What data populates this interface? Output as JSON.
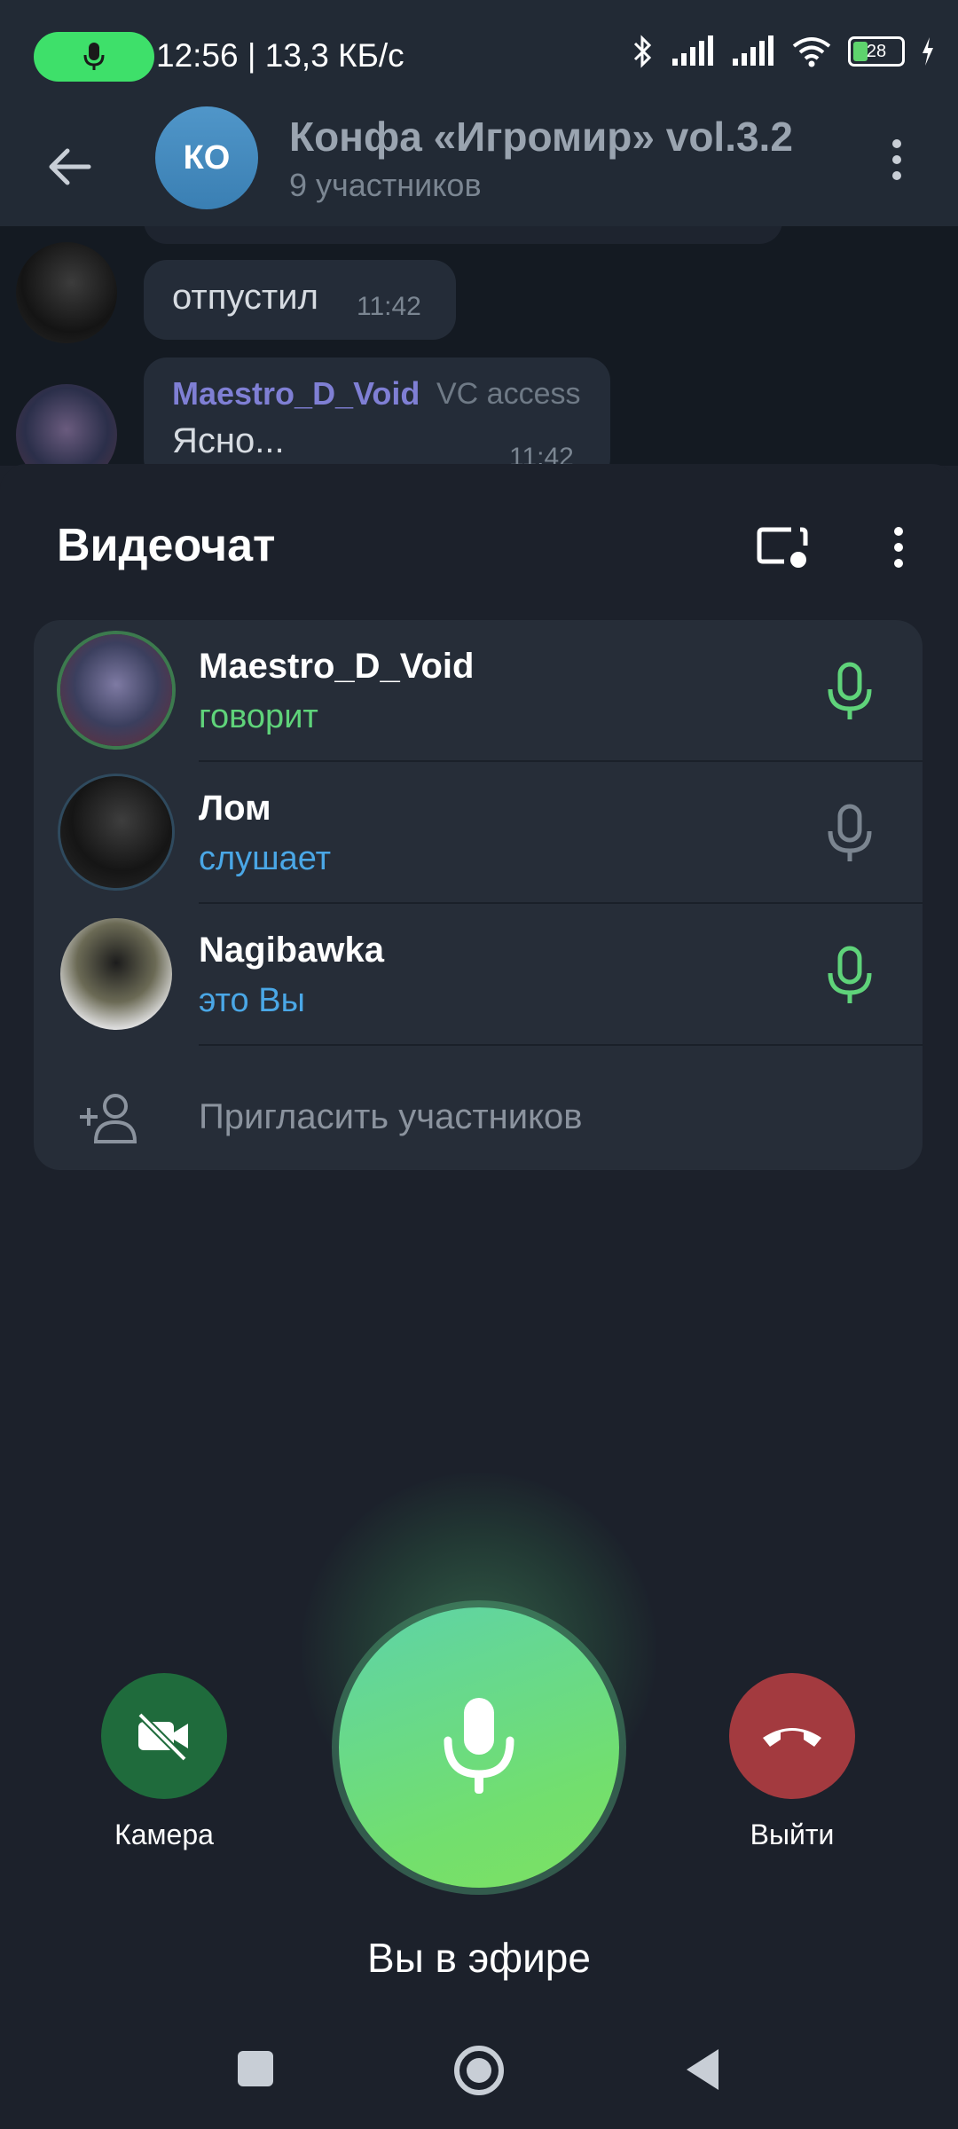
{
  "status_bar": {
    "time_speed": "12:56 | 13,3 КБ/с",
    "battery": "28",
    "icons": [
      "bluetooth-icon",
      "signal-icon",
      "signal-icon",
      "wifi-icon",
      "battery-icon",
      "charging-icon"
    ]
  },
  "chat_header": {
    "avatar_initials": "КО",
    "title": "Конфа «Игромир» vol.3.2",
    "subtitle": "9 участников"
  },
  "messages": [
    {
      "text": "отпустил",
      "time": "11:42"
    },
    {
      "sender": "Maestro_D_Void",
      "tag": "VC access",
      "text": "Ясно...",
      "time": "11:42"
    }
  ],
  "videochat": {
    "title": "Видеочат",
    "participants": [
      {
        "name": "Maestro_D_Void",
        "status": "говорит",
        "status_color": "#5fd37a",
        "mic": "active"
      },
      {
        "name": "Лом",
        "status": "слушает",
        "status_color": "#4aa7e6",
        "mic": "muted"
      },
      {
        "name": "Nagibawka",
        "status": "это Вы",
        "status_color": "#4aa7e6",
        "mic": "active"
      }
    ],
    "invite_label": "Пригласить участников"
  },
  "controls": {
    "camera_label": "Камера",
    "leave_label": "Выйти",
    "on_air_label": "Вы в эфире"
  },
  "colors": {
    "accent_green": "#5fd37a",
    "accent_blue": "#4aa7e6",
    "camera_button": "#1f6b3c",
    "leave_button": "#a33a3f",
    "sender_name": "#7f7fd4"
  }
}
